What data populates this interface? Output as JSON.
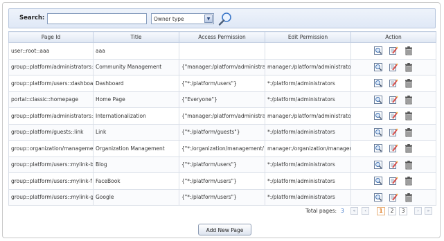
{
  "search": {
    "label": "Search:",
    "input_value": "",
    "owner_type": "Owner type"
  },
  "table": {
    "columns": [
      "Page Id",
      "Title",
      "Access Permission",
      "Edit Permission",
      "Action"
    ],
    "rows": [
      {
        "page_id": "user::root::aaa",
        "title": "aaa",
        "access": "",
        "edit": ""
      },
      {
        "page_id": "group::platform/administrators::",
        "title": "Community Management",
        "access": "{\"manager:/platform/administra",
        "edit": "manager:/platform/administrato"
      },
      {
        "page_id": "group::platform/users::dashboa",
        "title": "Dashboard",
        "access": "{\"*:/platform/users\"}",
        "edit": "*:/platform/administrators"
      },
      {
        "page_id": "portal::classic::homepage",
        "title": "Home Page",
        "access": "{\"Everyone\"}",
        "edit": "*:/platform/administrators"
      },
      {
        "page_id": "group::platform/administrators::",
        "title": "Internationalization",
        "access": "{\"manager:/platform/administra",
        "edit": "manager:/platform/administrato"
      },
      {
        "page_id": "group::platform/guests::link",
        "title": "Link",
        "access": "{\"*:/platform/guests\"}",
        "edit": "*:/platform/administrators"
      },
      {
        "page_id": "group::organization/manageme",
        "title": "Organization Management",
        "access": "{\"*:/organization/management/",
        "edit": "manager:/organization/manager"
      },
      {
        "page_id": "group::platform/users::mylink-b",
        "title": "Blog",
        "access": "{\"*:/platform/users\"}",
        "edit": "*:/platform/administrators"
      },
      {
        "page_id": "group::platform/users::mylink-f",
        "title": "FaceBook",
        "access": "{\"*:/platform/users\"}",
        "edit": "*:/platform/administrators"
      },
      {
        "page_id": "group::platform/users::mylink-g",
        "title": "Google",
        "access": "{\"*:/platform/users\"}",
        "edit": "*:/platform/administrators"
      }
    ],
    "action_icons": [
      "preview-icon",
      "edit-icon",
      "delete-icon"
    ]
  },
  "pager": {
    "total_label": "Total pages:",
    "total_value": "3",
    "pages": [
      "1",
      "2",
      "3"
    ],
    "current": "1"
  },
  "add_button": "Add New Page",
  "colors": {
    "accent_blue": "#3b73c6",
    "active_page": "#e07a1f",
    "header_bg": "#dfe7f3"
  }
}
